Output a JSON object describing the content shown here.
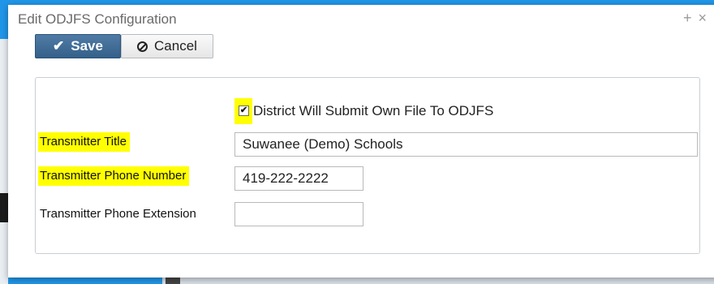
{
  "dialog": {
    "title": "Edit ODJFS Configuration",
    "controls": {
      "expand": "+",
      "close": "×"
    }
  },
  "toolbar": {
    "save_label": "Save",
    "cancel_label": "Cancel"
  },
  "form": {
    "checkbox": {
      "label": "District Will Submit Own File To ODJFS",
      "checked": true
    },
    "fields": [
      {
        "label": "Transmitter Title",
        "value": "Suwanee (Demo) Schools",
        "highlighted": true
      },
      {
        "label": "Transmitter Phone Number",
        "value": "419-222-2222",
        "highlighted": true
      },
      {
        "label": "Transmitter Phone Extension",
        "value": "",
        "highlighted": false
      }
    ]
  },
  "colors": {
    "highlight": "#ffff00",
    "save_button": "#3d6a94",
    "backdrop": "#2196e8"
  }
}
